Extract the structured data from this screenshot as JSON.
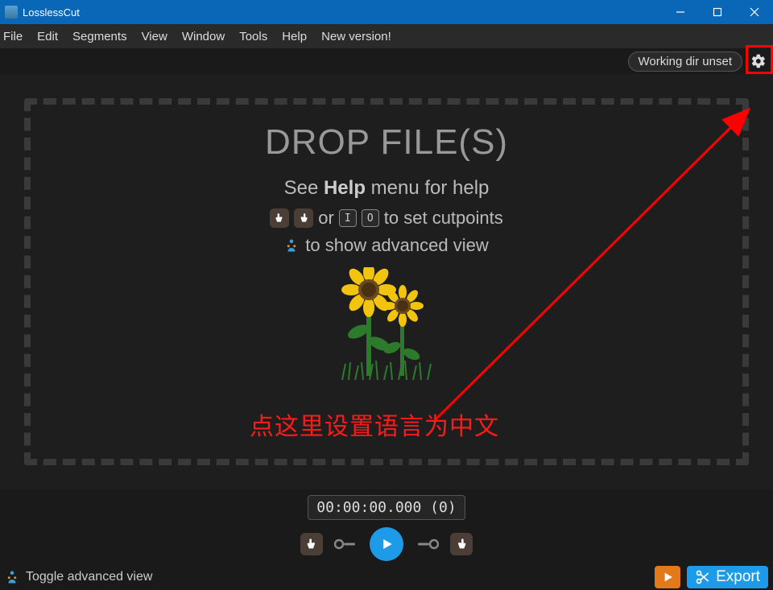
{
  "titlebar": {
    "title": "LosslessCut"
  },
  "menubar": {
    "file": "File",
    "edit": "Edit",
    "segments": "Segments",
    "view": "View",
    "window": "Window",
    "tools": "Tools",
    "help": "Help",
    "new_version": "New version!"
  },
  "toolbar": {
    "working_dir": "Working dir unset"
  },
  "drop": {
    "title": "DROP FILE(S)",
    "help_pre": "See ",
    "help_bold": "Help",
    "help_post": " menu for help",
    "or": "or",
    "key_i": "I",
    "key_o": "O",
    "cutpoints_post": "to set cutpoints",
    "advanced": "to show advanced view"
  },
  "annotation": {
    "text": "点这里设置语言为中文"
  },
  "timeline": {
    "timecode": "00:00:00.000 (0)"
  },
  "bottombar": {
    "toggle": "Toggle advanced view",
    "export": "Export"
  }
}
